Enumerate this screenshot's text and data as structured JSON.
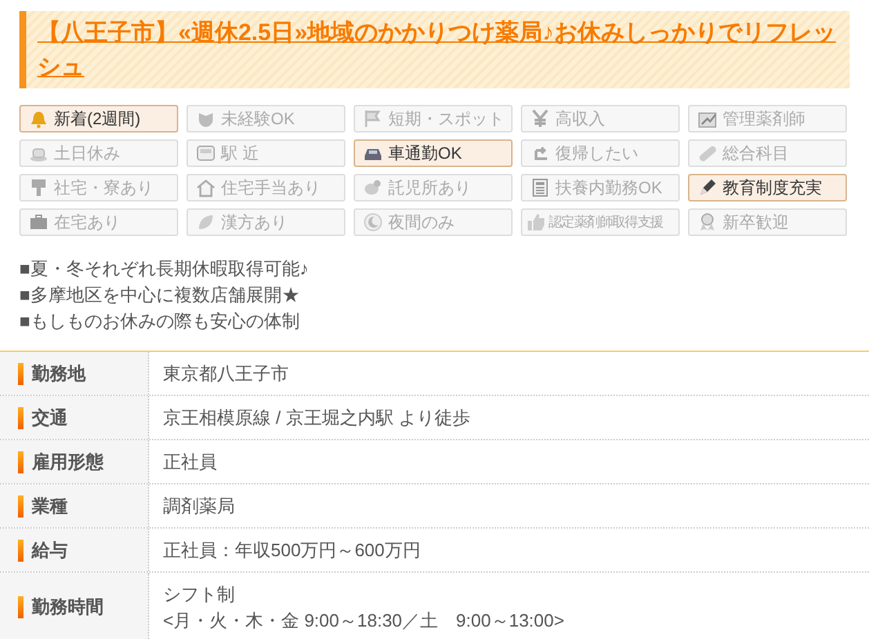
{
  "title": "【八王子市】«週休2.5日»地域のかかりつけ薬局♪お休みしっかりでリフレッシュ",
  "tags": [
    {
      "label": "新着(2週間)",
      "selected": true
    },
    {
      "label": "未経験OK",
      "selected": false
    },
    {
      "label": "短期・スポット",
      "selected": false
    },
    {
      "label": "高収入",
      "selected": false
    },
    {
      "label": "管理薬剤師",
      "selected": false
    },
    {
      "label": "土日休み",
      "selected": false
    },
    {
      "label": "駅 近",
      "selected": false
    },
    {
      "label": "車通勤OK",
      "selected": true
    },
    {
      "label": "復帰したい",
      "selected": false
    },
    {
      "label": "総合科目",
      "selected": false
    },
    {
      "label": "社宅・寮あり",
      "selected": false
    },
    {
      "label": "住宅手当あり",
      "selected": false
    },
    {
      "label": "託児所あり",
      "selected": false
    },
    {
      "label": "扶養内勤務OK",
      "selected": false
    },
    {
      "label": "教育制度充実",
      "selected": true
    },
    {
      "label": "在宅あり",
      "selected": false
    },
    {
      "label": "漢方あり",
      "selected": false
    },
    {
      "label": "夜間のみ",
      "selected": false
    },
    {
      "label": "認定薬剤師取得支援",
      "selected": false
    },
    {
      "label": "新卒歓迎",
      "selected": false
    }
  ],
  "highlights": [
    "■夏・冬それぞれ長期休暇取得可能♪",
    "■多摩地区を中心に複数店舗展開★",
    "■もしものお休みの際も安心の体制"
  ],
  "details": [
    {
      "label": "勤務地",
      "value": [
        "東京都八王子市"
      ]
    },
    {
      "label": "交通",
      "value": [
        "京王相模原線 / 京王堀之内駅 より徒歩"
      ]
    },
    {
      "label": "雇用形態",
      "value": [
        "正社員"
      ]
    },
    {
      "label": "業種",
      "value": [
        "調剤薬局"
      ]
    },
    {
      "label": "給与",
      "value": [
        "正社員：年収500万円～600万円"
      ]
    },
    {
      "label": "勤務時間",
      "value": [
        "シフト制",
        "<月・火・木・金 9:00～18:30／土　9:00～13:00>"
      ]
    }
  ]
}
